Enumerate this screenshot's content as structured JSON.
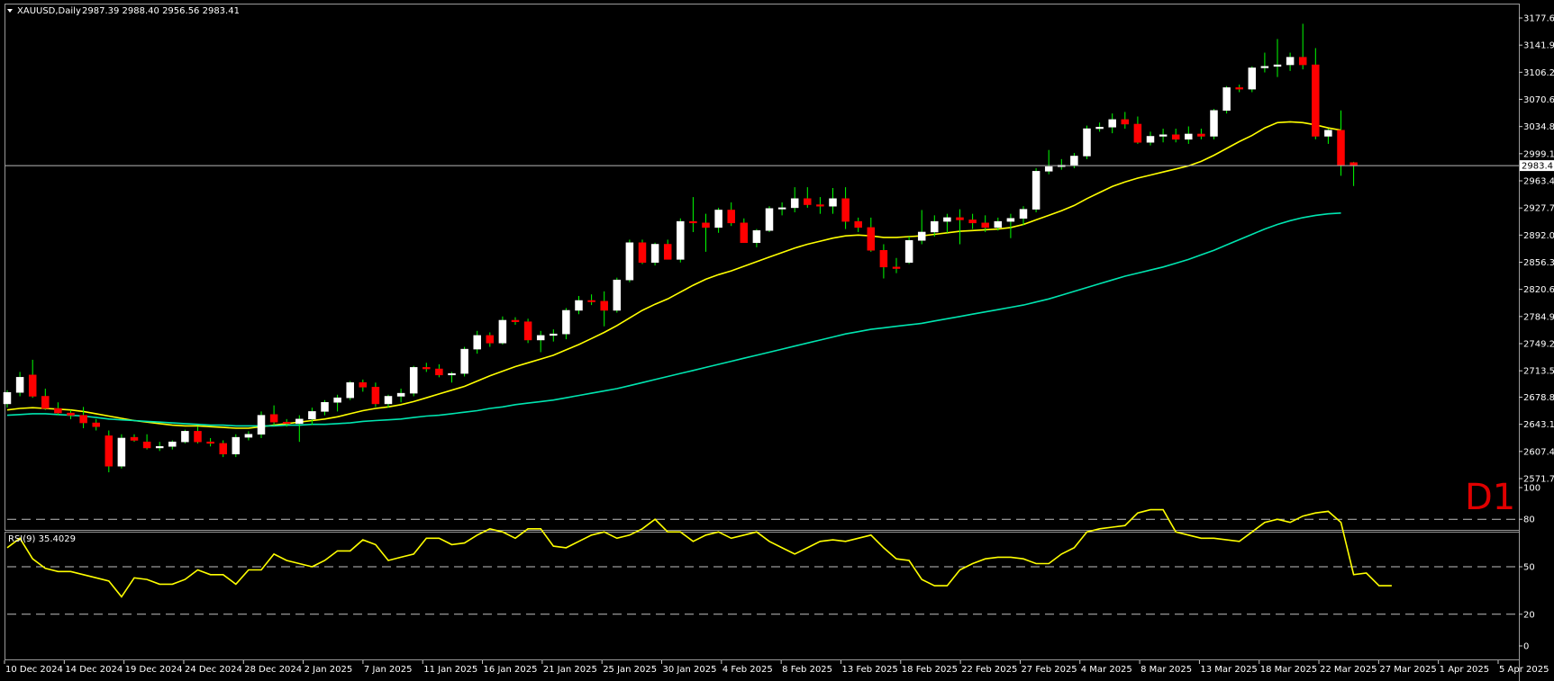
{
  "header": {
    "symbol": "XAUUSD,Daily",
    "ohlc": "2987.39 2988.40 2956.56 2983.41"
  },
  "timeframe_label": "D1",
  "current_price_label": "2983.41",
  "indicator": {
    "label": "RSI(9) 35.4029"
  },
  "colors": {
    "background": "#000000",
    "bull_candle": "#ffffff",
    "bear_candle": "#ff0000",
    "wick_green": "#00ff00",
    "ma_fast": "#ffff00",
    "ma_slow": "#00e5b0",
    "rsi_line": "#ffff00",
    "price_line": "#c0c0c0",
    "level_lines": "#c0c0c0"
  },
  "chart_data": [
    {
      "type": "candlestick",
      "title": "XAUUSD,Daily",
      "y_ticks": [
        "3177.60",
        "3141.90",
        "3106.20",
        "3070.60",
        "3034.80",
        "2999.10",
        "2963.40",
        "2927.70",
        "2892.00",
        "2856.30",
        "2820.60",
        "2784.90",
        "2749.20",
        "2713.50",
        "2678.80",
        "2643.10",
        "2607.40",
        "2571.70"
      ],
      "y_range": [
        2571.7,
        3177.6
      ],
      "x_tick_labels": [
        "10 Dec 2024",
        "14 Dec 2024",
        "19 Dec 2024",
        "24 Dec 2024",
        "28 Dec 2024",
        "2 Jan 2025",
        "7 Jan 2025",
        "11 Jan 2025",
        "16 Jan 2025",
        "21 Jan 2025",
        "25 Jan 2025",
        "30 Jan 2025",
        "4 Feb 2025",
        "8 Feb 2025",
        "13 Feb 2025",
        "18 Feb 2025",
        "22 Feb 2025",
        "27 Feb 2025",
        "4 Mar 2025",
        "8 Mar 2025",
        "13 Mar 2025",
        "18 Mar 2025",
        "22 Mar 2025",
        "27 Mar 2025",
        "1 Apr 2025",
        "5 Apr 2025"
      ],
      "candles": [
        [
          2670,
          2688,
          2665,
          2685
        ],
        [
          2685,
          2712,
          2680,
          2705
        ],
        [
          2708,
          2728,
          2678,
          2680
        ],
        [
          2680,
          2690,
          2662,
          2664
        ],
        [
          2664,
          2672,
          2655,
          2658
        ],
        [
          2658,
          2662,
          2650,
          2655
        ],
        [
          2655,
          2666,
          2638,
          2645
        ],
        [
          2645,
          2650,
          2635,
          2640
        ],
        [
          2628,
          2635,
          2580,
          2588
        ],
        [
          2588,
          2630,
          2585,
          2625
        ],
        [
          2626,
          2630,
          2620,
          2622
        ],
        [
          2620,
          2630,
          2610,
          2612
        ],
        [
          2612,
          2620,
          2608,
          2614
        ],
        [
          2614,
          2622,
          2610,
          2620
        ],
        [
          2620,
          2636,
          2618,
          2634
        ],
        [
          2634,
          2640,
          2618,
          2620
        ],
        [
          2620,
          2625,
          2614,
          2618
        ],
        [
          2618,
          2622,
          2600,
          2604
        ],
        [
          2604,
          2630,
          2600,
          2626
        ],
        [
          2626,
          2634,
          2622,
          2630
        ],
        [
          2630,
          2660,
          2625,
          2655
        ],
        [
          2656,
          2668,
          2642,
          2646
        ],
        [
          2646,
          2650,
          2640,
          2644
        ],
        [
          2644,
          2655,
          2620,
          2650
        ],
        [
          2650,
          2665,
          2642,
          2660
        ],
        [
          2660,
          2675,
          2655,
          2672
        ],
        [
          2672,
          2682,
          2660,
          2678
        ],
        [
          2678,
          2700,
          2675,
          2698
        ],
        [
          2698,
          2702,
          2686,
          2692
        ],
        [
          2692,
          2698,
          2666,
          2670
        ],
        [
          2670,
          2682,
          2665,
          2680
        ],
        [
          2680,
          2690,
          2672,
          2684
        ],
        [
          2684,
          2720,
          2680,
          2718
        ],
        [
          2718,
          2724,
          2712,
          2716
        ],
        [
          2716,
          2722,
          2705,
          2708
        ],
        [
          2708,
          2712,
          2698,
          2710
        ],
        [
          2710,
          2745,
          2706,
          2742
        ],
        [
          2742,
          2766,
          2736,
          2760
        ],
        [
          2760,
          2764,
          2745,
          2750
        ],
        [
          2750,
          2785,
          2748,
          2780
        ],
        [
          2780,
          2784,
          2774,
          2778
        ],
        [
          2778,
          2782,
          2750,
          2754
        ],
        [
          2754,
          2766,
          2738,
          2760
        ],
        [
          2760,
          2768,
          2752,
          2762
        ],
        [
          2762,
          2796,
          2755,
          2793
        ],
        [
          2793,
          2812,
          2788,
          2806
        ],
        [
          2806,
          2814,
          2800,
          2805
        ],
        [
          2805,
          2818,
          2772,
          2793
        ],
        [
          2793,
          2836,
          2790,
          2833
        ],
        [
          2833,
          2886,
          2830,
          2882
        ],
        [
          2882,
          2886,
          2854,
          2856
        ],
        [
          2856,
          2882,
          2852,
          2880
        ],
        [
          2880,
          2886,
          2860,
          2860
        ],
        [
          2860,
          2914,
          2856,
          2910
        ],
        [
          2910,
          2942,
          2896,
          2908
        ],
        [
          2908,
          2920,
          2870,
          2902
        ],
        [
          2902,
          2928,
          2895,
          2925
        ],
        [
          2925,
          2935,
          2904,
          2908
        ],
        [
          2908,
          2914,
          2882,
          2882
        ],
        [
          2882,
          2900,
          2876,
          2898
        ],
        [
          2898,
          2930,
          2896,
          2927
        ],
        [
          2927,
          2935,
          2918,
          2928
        ],
        [
          2928,
          2955,
          2922,
          2940
        ],
        [
          2940,
          2955,
          2928,
          2932
        ],
        [
          2932,
          2942,
          2920,
          2930
        ],
        [
          2930,
          2954,
          2920,
          2940
        ],
        [
          2940,
          2955,
          2900,
          2910
        ],
        [
          2910,
          2915,
          2896,
          2902
        ],
        [
          2902,
          2915,
          2870,
          2872
        ],
        [
          2872,
          2880,
          2835,
          2850
        ],
        [
          2850,
          2862,
          2842,
          2848
        ],
        [
          2856,
          2890,
          2854,
          2885
        ],
        [
          2885,
          2925,
          2880,
          2896
        ],
        [
          2896,
          2918,
          2890,
          2910
        ],
        [
          2910,
          2920,
          2895,
          2915
        ],
        [
          2915,
          2926,
          2880,
          2912
        ],
        [
          2912,
          2920,
          2900,
          2908
        ],
        [
          2908,
          2918,
          2896,
          2902
        ],
        [
          2902,
          2915,
          2898,
          2910
        ],
        [
          2910,
          2920,
          2888,
          2914
        ],
        [
          2914,
          2930,
          2905,
          2926
        ],
        [
          2926,
          2980,
          2922,
          2976
        ],
        [
          2976,
          3004,
          2972,
          2982
        ],
        [
          2982,
          2992,
          2978,
          2984
        ],
        [
          2984,
          3000,
          2980,
          2996
        ],
        [
          2996,
          3036,
          2992,
          3032
        ],
        [
          3032,
          3040,
          3028,
          3034
        ],
        [
          3034,
          3052,
          3026,
          3044
        ],
        [
          3044,
          3054,
          3032,
          3038
        ],
        [
          3038,
          3048,
          3012,
          3014
        ],
        [
          3014,
          3028,
          3010,
          3022
        ],
        [
          3022,
          3032,
          3014,
          3024
        ],
        [
          3024,
          3032,
          3014,
          3018
        ],
        [
          3018,
          3035,
          3012,
          3025
        ],
        [
          3025,
          3032,
          3018,
          3022
        ],
        [
          3022,
          3058,
          3018,
          3056
        ],
        [
          3056,
          3088,
          3052,
          3086
        ],
        [
          3086,
          3090,
          3080,
          3084
        ],
        [
          3084,
          3114,
          3080,
          3112
        ],
        [
          3112,
          3132,
          3106,
          3114
        ],
        [
          3114,
          3150,
          3100,
          3116
        ],
        [
          3116,
          3132,
          3108,
          3126
        ],
        [
          3126,
          3170,
          3110,
          3116
        ],
        [
          3116,
          3138,
          3018,
          3022
        ],
        [
          3022,
          3032,
          3012,
          3030
        ],
        [
          3030,
          3056,
          2970,
          2984
        ],
        [
          2987.39,
          2988.4,
          2956.56,
          2983.41
        ]
      ],
      "series": [
        {
          "values": [
            2662,
            2664,
            2665,
            2664,
            2663,
            2662,
            2660,
            2657,
            2654,
            2651,
            2648,
            2646,
            2644,
            2642,
            2641,
            2641,
            2640,
            2639,
            2638,
            2638,
            2640,
            2642,
            2644,
            2646,
            2648,
            2650,
            2653,
            2657,
            2661,
            2664,
            2666,
            2669,
            2673,
            2678,
            2683,
            2688,
            2693,
            2700,
            2707,
            2713,
            2719,
            2724,
            2729,
            2734,
            2741,
            2748,
            2756,
            2764,
            2773,
            2783,
            2793,
            2801,
            2808,
            2817,
            2826,
            2834,
            2840,
            2845,
            2851,
            2857,
            2863,
            2869,
            2875,
            2880,
            2884,
            2888,
            2891,
            2892,
            2891,
            2889,
            2889,
            2890,
            2891,
            2893,
            2895,
            2897,
            2898,
            2899,
            2900,
            2902,
            2906,
            2912,
            2918,
            2924,
            2931,
            2940,
            2948,
            2956,
            2962,
            2967,
            2971,
            2975,
            2979,
            2983,
            2989,
            2997,
            3006,
            3015,
            3023,
            3033,
            3040,
            3041,
            3040,
            3037,
            3033,
            3030
          ]
        },
        {
          "values": [
            2655,
            2656,
            2657,
            2657,
            2656,
            2655,
            2654,
            2652,
            2650,
            2649,
            2648,
            2647,
            2646,
            2645,
            2644,
            2643,
            2642,
            2642,
            2641,
            2641,
            2641,
            2641,
            2642,
            2642,
            2643,
            2643,
            2644,
            2645,
            2647,
            2648,
            2649,
            2650,
            2652,
            2654,
            2655,
            2657,
            2659,
            2661,
            2664,
            2666,
            2669,
            2671,
            2673,
            2675,
            2678,
            2681,
            2684,
            2687,
            2690,
            2694,
            2698,
            2702,
            2706,
            2710,
            2714,
            2718,
            2722,
            2726,
            2730,
            2734,
            2738,
            2742,
            2746,
            2750,
            2754,
            2758,
            2762,
            2765,
            2768,
            2770,
            2772,
            2774,
            2776,
            2779,
            2782,
            2785,
            2788,
            2791,
            2794,
            2797,
            2800,
            2804,
            2808,
            2813,
            2818,
            2823,
            2828,
            2833,
            2838,
            2842,
            2846,
            2850,
            2855,
            2860,
            2866,
            2872,
            2879,
            2886,
            2893,
            2900,
            2906,
            2911,
            2915,
            2918,
            2920,
            2921
          ]
        }
      ]
    },
    {
      "type": "line",
      "title": "RSI(9) 35.4029",
      "y_ticks": [
        "100",
        "80",
        "50",
        "20",
        "0"
      ],
      "y_range": [
        0,
        100
      ],
      "levels": [
        80,
        50,
        20
      ],
      "series": [
        {
          "values": [
            62,
            68,
            55,
            49,
            47,
            47,
            45,
            43,
            41,
            31,
            43,
            42,
            39,
            39,
            42,
            48,
            45,
            45,
            39,
            48,
            48,
            58,
            54,
            52,
            50,
            54,
            60,
            60,
            67,
            64,
            54,
            56,
            58,
            68,
            68,
            64,
            65,
            70,
            74,
            72,
            68,
            74,
            74,
            63,
            62,
            66,
            70,
            72,
            68,
            70,
            74,
            80,
            72,
            72,
            66,
            70,
            72,
            68,
            70,
            72,
            66,
            62,
            58,
            62,
            66,
            67,
            66,
            68,
            70,
            62,
            55,
            54,
            42,
            38,
            38,
            48,
            52,
            55,
            56,
            56,
            55,
            52,
            52,
            58,
            62,
            72,
            74,
            75,
            76,
            84,
            86,
            86,
            72,
            70,
            68,
            68,
            67,
            66,
            72,
            78,
            80,
            78,
            82,
            84,
            85,
            78,
            45,
            46,
            38,
            38
          ]
        }
      ]
    }
  ]
}
